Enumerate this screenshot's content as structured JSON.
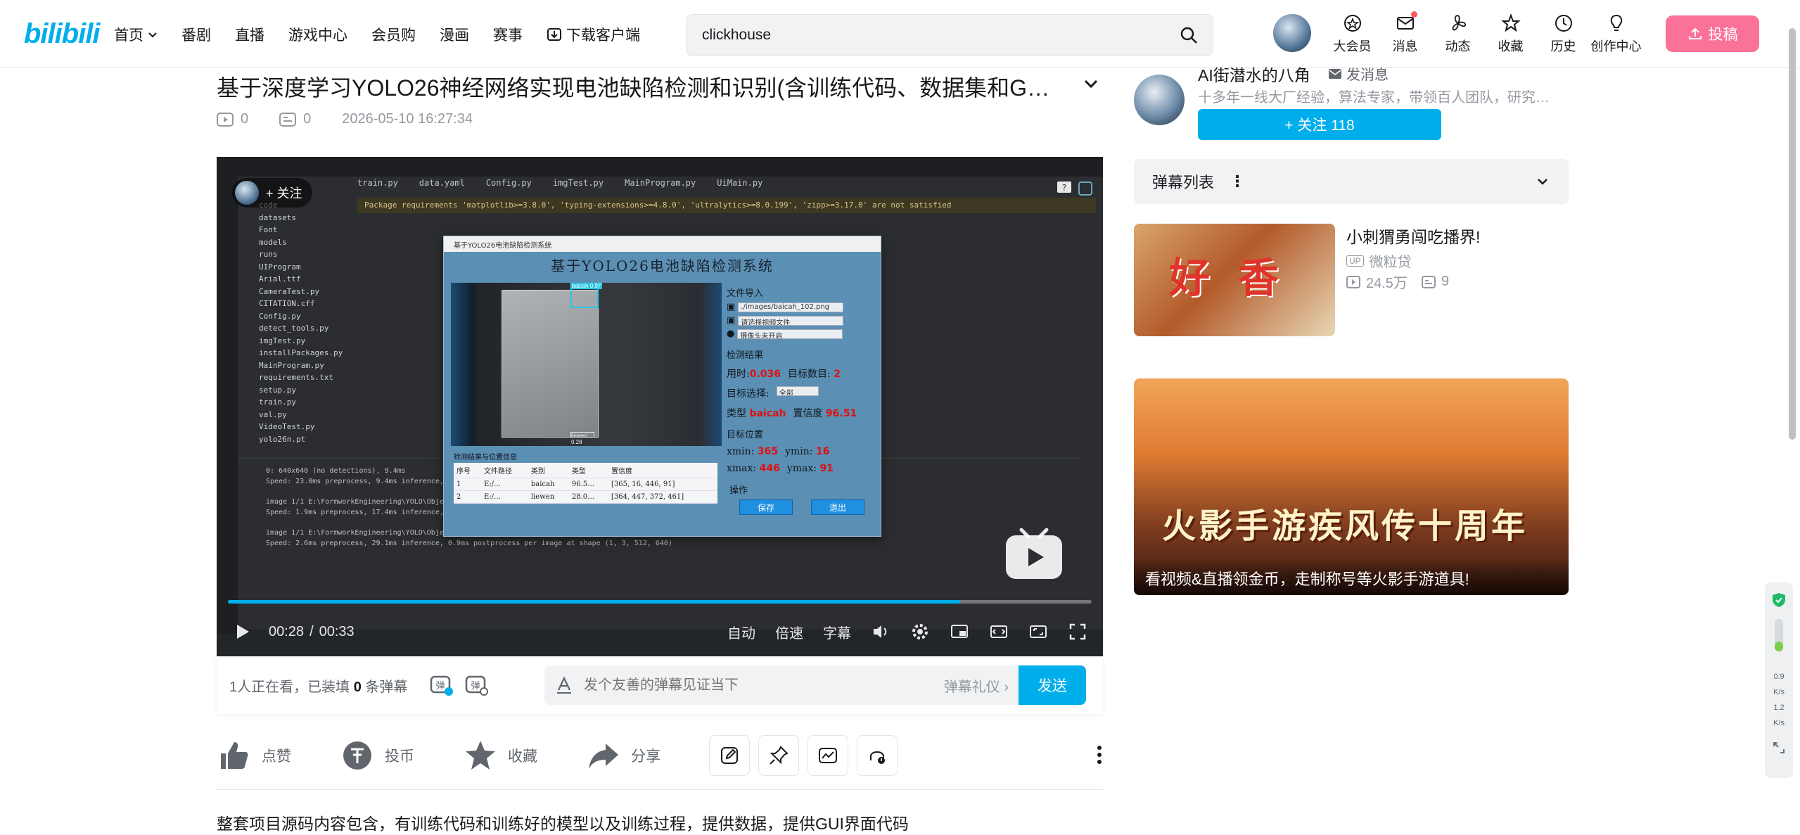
{
  "header": {
    "logo": "bilibili",
    "nav": [
      "首页",
      "番剧",
      "直播",
      "游戏中心",
      "会员购",
      "漫画",
      "赛事",
      "下载客户端"
    ],
    "search_value": "clickhouse",
    "right_nav": [
      "大会员",
      "消息",
      "动态",
      "收藏",
      "历史",
      "创作中心"
    ],
    "upload_label": "投稿"
  },
  "video": {
    "title": "基于深度学习YOLO26神经网络实现电池缺陷检测和识别(含训练代码、数据集和G…",
    "views": "0",
    "danmaku_count": "0",
    "date": "2026-05-10 16:27:34"
  },
  "player": {
    "follow_label": "+ 关注",
    "time_current": "00:28",
    "time_sep": "/",
    "time_total": "00:33",
    "progress": 0.848,
    "controls": [
      "自动",
      "倍速",
      "字幕"
    ],
    "app": {
      "window_title": "基于YOLO26电池缺陷检测系统",
      "heading": "基于YOLO26电池缺陷检测系统",
      "file_section": "文件导入",
      "file_path": "./images/baicah_102.png",
      "video_placeholder": "请选择视频文件",
      "camera_placeholder": "摄像头未开启",
      "result_section": "检测结果",
      "time_label": "用时:",
      "time_value": "0.036",
      "count_label": "目标数目:",
      "count_value": "2",
      "select_label": "目标选择:",
      "select_value": "全部",
      "type_label": "类型",
      "type_value": "baicah",
      "conf_label": "置信度",
      "conf_value": "96.51",
      "pos_section": "目标位置",
      "xmin_label": "xmin:",
      "xmin_value": "365",
      "ymin_label": "ymin:",
      "ymin_value": "16",
      "xmax_label": "xmax:",
      "xmax_value": "446",
      "ymax_label": "ymax:",
      "ymax_value": "91",
      "table_caption": "检测结果与位置信息",
      "table_headers": [
        "序号",
        "文件路径",
        "类别",
        "类型",
        "置信度"
      ],
      "table_rows": [
        [
          "1",
          "E:/…",
          "baicah",
          "96.5…",
          "[365, 16, 446, 91]"
        ],
        [
          "2",
          "E:/…",
          "liewen",
          "28.0…",
          "[364, 447, 372, 461]"
        ]
      ],
      "op_section": "操作",
      "save_label": "保存",
      "exit_label": "退出",
      "bbox1_label": "baicah 0.97",
      "bbox2_label": "liewen 0.28"
    },
    "ide": {
      "tabs": [
        "train.py",
        "data.yaml",
        "Config.py",
        "imgTest.py",
        "MainProgram.py",
        "UiMain.py"
      ],
      "warning": "Package requirements 'matplotlib>=3.8.0', 'typing-extensions>=4.8.0', 'ultralytics>=8.0.199', 'zipp>=3.17.0' are not satisfied",
      "tree": [
        "code",
        "datasets",
        "Font",
        "models",
        "runs",
        "UIProgram",
        "Arial.ttf",
        "CameraTest.py",
        "CITATION.cff",
        "Config.py",
        "detect_tools.py",
        "imgTest.py",
        "installPackages.py",
        "MainProgram.py",
        "requirements.txt",
        "setup.py",
        "train.py",
        "val.py",
        "VideoTest.py",
        "yolo26n.pt"
      ],
      "console": [
        "0: 640x640 (no detections), 9.4ms",
        "Speed: 23.0ms preprocess, 9.4ms inference,",
        "image 1/1 E:\\FormworkEngineering\\YOLO\\ObjectDetection\\BatteryDefect_yolo26\\data\\test\\images\\baicah_16.png: 512x640 1 baicah, 17.4ms",
        "Speed: 1.9ms preprocess, 17.4ms inference, 0.3ms postprocess per image at shape (1, 3, 512, 640)",
        "image 1/1 E:\\FormworkEngineering\\YOLO\\ObjectDetection\\BatteryDefect_yolo26\\data\\test\\images\\baicah_102.png: 512x640 1 baicah, 1 liewen, 29.1ms",
        "Speed: 2.6ms preprocess, 29.1ms inference, 0.9ms postprocess per image at shape (1, 3, 512, 640)"
      ]
    }
  },
  "danmaku_bar": {
    "viewers_prefix": "1人正在看，已装填",
    "viewers_count": "0",
    "viewers_suffix": "条弹幕",
    "input_placeholder": "发个友善的弹幕见证当下",
    "etiquette": "弹幕礼仪",
    "send_label": "发送"
  },
  "actions": {
    "like": "点赞",
    "coin": "投币",
    "favorite": "收藏",
    "share": "分享"
  },
  "description": "整套项目源码内容包含，有训练代码和训练好的模型以及训练过程，提供数据，提供GUI界面代码",
  "uploader": {
    "name": "AI街潜水的八角",
    "message_label": "发消息",
    "bio": "十多年一线大厂经验，算法专家，带领百人团队，研究…",
    "follow_label": "+ 关注 118"
  },
  "danmaku_list_label": "弹幕列表",
  "recommend": {
    "title": "小刺猬勇闯吃播界!",
    "up_tag": "UP",
    "uploader": "微粒贷",
    "views": "24.5万",
    "danmaku": "9",
    "thumb_text": "好香"
  },
  "ad": {
    "banner": "火影手游疾风传十周年",
    "caption": "看视频&直播领金币，走制称号等火影手游道具!"
  },
  "widget": {
    "down_speed": "0.9",
    "down_unit": "K/s",
    "up_speed": "1.2",
    "up_unit": "K/s"
  },
  "colors": {
    "brand_blue": "#00aeec",
    "brand_pink": "#fb7299",
    "detect_red": "#e01010"
  }
}
